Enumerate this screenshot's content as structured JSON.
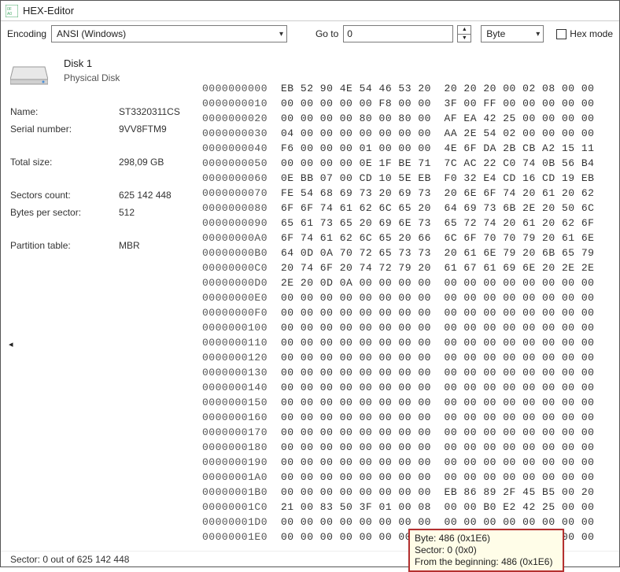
{
  "window": {
    "title": "HEX-Editor"
  },
  "toolbar": {
    "encoding_label": "Encoding",
    "encoding_value": "ANSI (Windows)",
    "goto_label": "Go to",
    "goto_value": "0",
    "unit_value": "Byte",
    "hexmode_label": "Hex mode"
  },
  "disk": {
    "name": "Disk 1",
    "type": "Physical Disk",
    "fields": [
      {
        "k": "Name:",
        "v": "ST3320311CS"
      },
      {
        "k": "Serial number:",
        "v": "9VV8FTM9"
      }
    ],
    "fields2": [
      {
        "k": "Total size:",
        "v": "298,09 GB"
      }
    ],
    "fields3": [
      {
        "k": "Sectors count:",
        "v": "625 142 448"
      },
      {
        "k": "Bytes per sector:",
        "v": "512"
      }
    ],
    "fields4": [
      {
        "k": "Partition table:",
        "v": "MBR"
      }
    ]
  },
  "hex": {
    "rows": [
      {
        "addr": "0000000000",
        "bytes": "EB 52 90 4E 54 46 53 20  20 20 20 00 02 08 00 00"
      },
      {
        "addr": "0000000010",
        "bytes": "00 00 00 00 00 F8 00 00  3F 00 FF 00 00 00 00 00"
      },
      {
        "addr": "0000000020",
        "bytes": "00 00 00 00 80 00 80 00  AF EA 42 25 00 00 00 00"
      },
      {
        "addr": "0000000030",
        "bytes": "04 00 00 00 00 00 00 00  AA 2E 54 02 00 00 00 00"
      },
      {
        "addr": "0000000040",
        "bytes": "F6 00 00 00 01 00 00 00  4E 6F DA 2B CB A2 15 11"
      },
      {
        "addr": "0000000050",
        "bytes": "00 00 00 00 0E 1F BE 71  7C AC 22 C0 74 0B 56 B4"
      },
      {
        "addr": "0000000060",
        "bytes": "0E BB 07 00 CD 10 5E EB  F0 32 E4 CD 16 CD 19 EB"
      },
      {
        "addr": "0000000070",
        "bytes": "FE 54 68 69 73 20 69 73  20 6E 6F 74 20 61 20 62"
      },
      {
        "addr": "0000000080",
        "bytes": "6F 6F 74 61 62 6C 65 20  64 69 73 6B 2E 20 50 6C"
      },
      {
        "addr": "0000000090",
        "bytes": "65 61 73 65 20 69 6E 73  65 72 74 20 61 20 62 6F"
      },
      {
        "addr": "00000000A0",
        "bytes": "6F 74 61 62 6C 65 20 66  6C 6F 70 70 79 20 61 6E"
      },
      {
        "addr": "00000000B0",
        "bytes": "64 0D 0A 70 72 65 73 73  20 61 6E 79 20 6B 65 79"
      },
      {
        "addr": "00000000C0",
        "bytes": "20 74 6F 20 74 72 79 20  61 67 61 69 6E 20 2E 2E"
      },
      {
        "addr": "00000000D0",
        "bytes": "2E 20 0D 0A 00 00 00 00  00 00 00 00 00 00 00 00"
      },
      {
        "addr": "00000000E0",
        "bytes": "00 00 00 00 00 00 00 00  00 00 00 00 00 00 00 00"
      },
      {
        "addr": "00000000F0",
        "bytes": "00 00 00 00 00 00 00 00  00 00 00 00 00 00 00 00"
      },
      {
        "addr": "0000000100",
        "bytes": "00 00 00 00 00 00 00 00  00 00 00 00 00 00 00 00"
      },
      {
        "addr": "0000000110",
        "bytes": "00 00 00 00 00 00 00 00  00 00 00 00 00 00 00 00"
      },
      {
        "addr": "0000000120",
        "bytes": "00 00 00 00 00 00 00 00  00 00 00 00 00 00 00 00"
      },
      {
        "addr": "0000000130",
        "bytes": "00 00 00 00 00 00 00 00  00 00 00 00 00 00 00 00"
      },
      {
        "addr": "0000000140",
        "bytes": "00 00 00 00 00 00 00 00  00 00 00 00 00 00 00 00"
      },
      {
        "addr": "0000000150",
        "bytes": "00 00 00 00 00 00 00 00  00 00 00 00 00 00 00 00"
      },
      {
        "addr": "0000000160",
        "bytes": "00 00 00 00 00 00 00 00  00 00 00 00 00 00 00 00"
      },
      {
        "addr": "0000000170",
        "bytes": "00 00 00 00 00 00 00 00  00 00 00 00 00 00 00 00"
      },
      {
        "addr": "0000000180",
        "bytes": "00 00 00 00 00 00 00 00  00 00 00 00 00 00 00 00"
      },
      {
        "addr": "0000000190",
        "bytes": "00 00 00 00 00 00 00 00  00 00 00 00 00 00 00 00"
      },
      {
        "addr": "00000001A0",
        "bytes": "00 00 00 00 00 00 00 00  00 00 00 00 00 00 00 00"
      },
      {
        "addr": "00000001B0",
        "bytes": "00 00 00 00 00 00 00 00  EB 86 89 2F 45 B5 00 20"
      },
      {
        "addr": "00000001C0",
        "bytes": "21 00 83 50 3F 01 00 08  00 00 B0 E2 42 25 00 00"
      },
      {
        "addr": "00000001D0",
        "bytes": "00 00 00 00 00 00 00 00  00 00 00 00 00 00 00 00"
      },
      {
        "addr": "00000001E0",
        "bytes": "00 00 00 00 00 00 00 00  00 00 00 00 00 00 00 00"
      }
    ]
  },
  "tooltip": {
    "line1": "Byte: 486 (0x1E6)",
    "line2": "Sector: 0 (0x0)",
    "line3": "From the beginning: 486 (0x1E6)"
  },
  "status": {
    "text": "Sector: 0 out of 625 142 448"
  }
}
